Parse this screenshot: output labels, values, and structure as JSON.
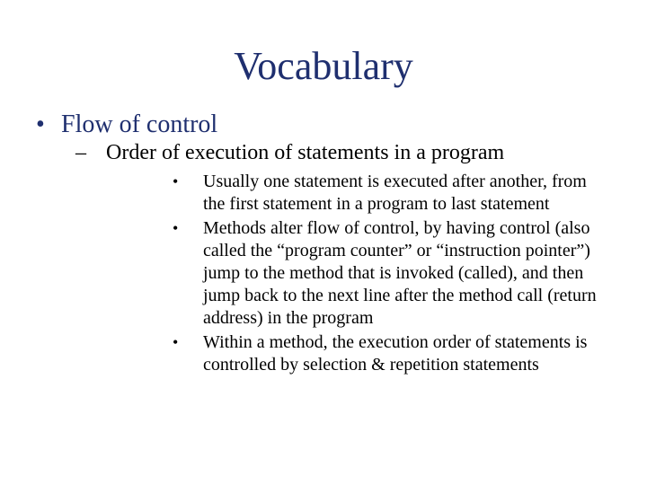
{
  "title": "Vocabulary",
  "l1": {
    "bullet": "•",
    "text": "Flow of control"
  },
  "l2": {
    "bullet": "–",
    "text": "Order of execution of statements in a program"
  },
  "l3": {
    "bullet": "•",
    "items": [
      "Usually one statement is executed after another, from the first statement in a program to last statement",
      "Methods alter flow of control, by having control (also called the “program counter” or “instruction pointer”) jump to the method that is invoked (called), and then jump back to the next line after the method call (return address) in the program",
      "Within a method, the execution order of statements is controlled by selection & repetition statements"
    ]
  }
}
